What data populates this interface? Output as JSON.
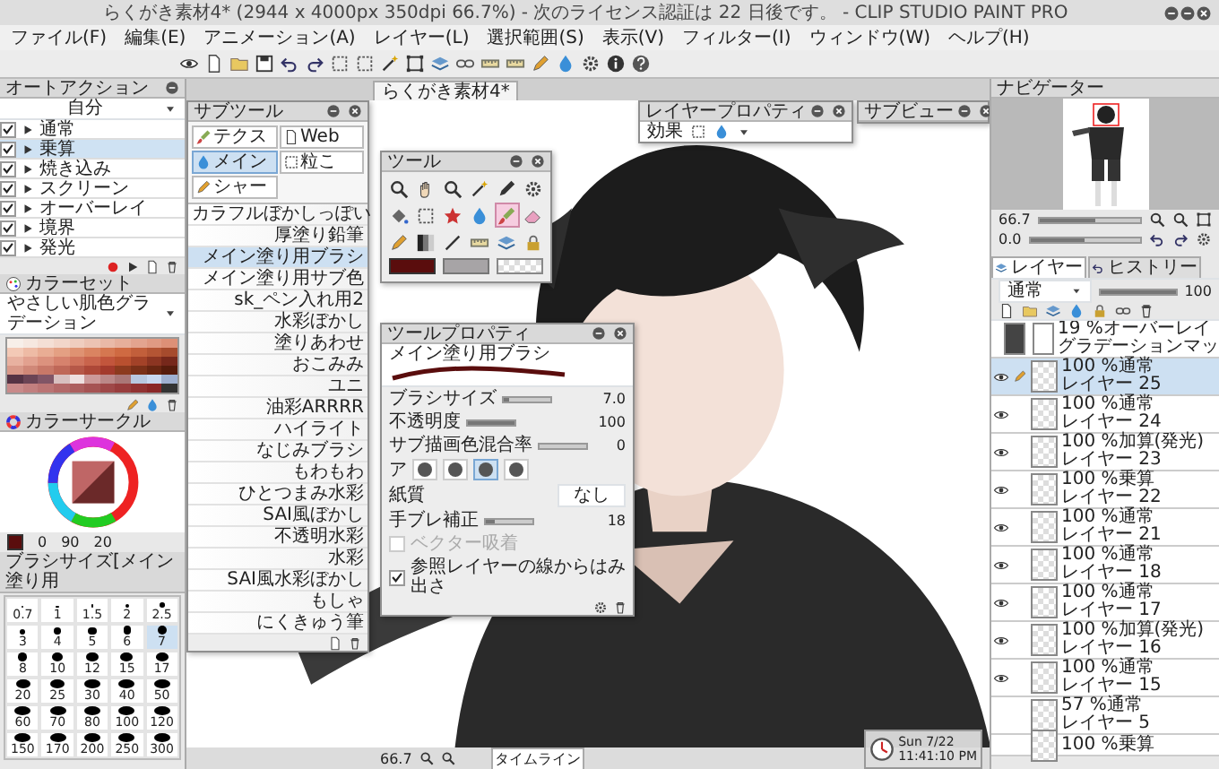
{
  "window": {
    "title": "らくがき素材4* (2944 x 4000px 350dpi 66.7%) - 次のライセンス認証は 22 日後です。 - CLIP STUDIO PAINT PRO"
  },
  "menu": [
    "ファイル(F)",
    "編集(E)",
    "アニメーション(A)",
    "レイヤー(L)",
    "選択範囲(S)",
    "表示(V)",
    "フィルター(I)",
    "ウィンドウ(W)",
    "ヘルプ(H)"
  ],
  "auto_action": {
    "title": "オートアクション",
    "set": "自分",
    "items": [
      {
        "label": "通常",
        "checked": true,
        "selected": false
      },
      {
        "label": "乗算",
        "checked": true,
        "selected": true
      },
      {
        "label": "焼き込み",
        "checked": true,
        "selected": false
      },
      {
        "label": "スクリーン",
        "checked": true,
        "selected": false
      },
      {
        "label": "オーバーレイ",
        "checked": true,
        "selected": false
      },
      {
        "label": "境界",
        "checked": true,
        "selected": false
      },
      {
        "label": "発光",
        "checked": true,
        "selected": false
      }
    ]
  },
  "color_set": {
    "title": "カラーセット",
    "set_name": "やさしい肌色グラデーション",
    "swatches": [
      {
        "color": "#f7efe9"
      },
      {
        "color": "#f6e8e0"
      },
      {
        "color": "#f4dfd5"
      },
      {
        "color": "#f2d6ca"
      },
      {
        "color": "#efcdbf"
      },
      {
        "color": "#ecc3b3"
      },
      {
        "color": "#e9b9a7"
      },
      {
        "color": "#e6af9b"
      },
      {
        "color": "#e3a48f"
      },
      {
        "color": "#e09a83"
      },
      {
        "color": "#dd9077"
      },
      {
        "color": "#f3c9b6"
      },
      {
        "color": "#eebba5"
      },
      {
        "color": "#e9ad94"
      },
      {
        "color": "#e4a083"
      },
      {
        "color": "#df9272"
      },
      {
        "color": "#da8461"
      },
      {
        "color": "#d57750"
      },
      {
        "color": "#cf6a42"
      },
      {
        "color": "#c25f3b"
      },
      {
        "color": "#b45534"
      },
      {
        "color": "#a64b2d"
      },
      {
        "color": "#e8b1a0"
      },
      {
        "color": "#e2a18f"
      },
      {
        "color": "#dc927e"
      },
      {
        "color": "#d6826d"
      },
      {
        "color": "#d0735c"
      },
      {
        "color": "#c9644c"
      },
      {
        "color": "#c2553c"
      },
      {
        "color": "#b9502f"
      },
      {
        "color": "#a34228"
      },
      {
        "color": "#8c3522"
      },
      {
        "color": "#76281b"
      },
      {
        "color": "#d99888"
      },
      {
        "color": "#d08878"
      },
      {
        "color": "#c87868"
      },
      {
        "color": "#bf6858"
      },
      {
        "color": "#b65848"
      },
      {
        "color": "#ad4838"
      },
      {
        "color": "#a33a2c"
      },
      {
        "color": "#8c3a1e"
      },
      {
        "color": "#7a3018"
      },
      {
        "color": "#682612"
      },
      {
        "color": "#561c0c"
      },
      {
        "color": "#553344"
      },
      {
        "color": "#6b4455"
      },
      {
        "color": "#815566"
      },
      {
        "color": "#d8c0c0"
      },
      {
        "color": "#eee0e0"
      },
      {
        "color": "#cc9999"
      },
      {
        "color": "#bb8888"
      },
      {
        "color": "#aa7777"
      },
      {
        "color": "#b8c8e0"
      },
      {
        "color": "#c8d8f0"
      },
      {
        "color": "#9fb0d0"
      },
      {
        "color": "#c98a8a"
      },
      {
        "color": "#c27f7f"
      },
      {
        "color": "#bb7474"
      },
      {
        "color": "#b46969"
      },
      {
        "color": "#ad5e5e"
      },
      {
        "color": "#a65353"
      },
      {
        "color": "#9f4848"
      },
      {
        "color": "#983d3d"
      },
      {
        "color": "#913232"
      },
      {
        "color": "#8a2727"
      },
      {
        "color": "#333333"
      }
    ]
  },
  "color_circle": {
    "title": "カラーサークル",
    "values": [
      "0",
      "90",
      "20"
    ]
  },
  "brush_size": {
    "title": "ブラシサイズ[メイン塗り用",
    "sizes": [
      {
        "label": "0.7",
        "selected": false
      },
      {
        "label": "1",
        "selected": false
      },
      {
        "label": "1.5",
        "selected": false
      },
      {
        "label": "2",
        "selected": false
      },
      {
        "label": "2.5",
        "selected": false
      },
      {
        "label": "3",
        "selected": false
      },
      {
        "label": "4",
        "selected": false
      },
      {
        "label": "5",
        "selected": false
      },
      {
        "label": "6",
        "selected": false
      },
      {
        "label": "7",
        "selected": true
      },
      {
        "label": "8",
        "selected": false
      },
      {
        "label": "10",
        "selected": false
      },
      {
        "label": "12",
        "selected": false
      },
      {
        "label": "15",
        "selected": false
      },
      {
        "label": "17",
        "selected": false
      },
      {
        "label": "20",
        "selected": false
      },
      {
        "label": "25",
        "selected": false
      },
      {
        "label": "30",
        "selected": false
      },
      {
        "label": "40",
        "selected": false
      },
      {
        "label": "50",
        "selected": false
      },
      {
        "label": "60",
        "selected": false
      },
      {
        "label": "70",
        "selected": false
      },
      {
        "label": "80",
        "selected": false
      },
      {
        "label": "100",
        "selected": false
      },
      {
        "label": "120",
        "selected": false
      },
      {
        "label": "150",
        "selected": false
      },
      {
        "label": "170",
        "selected": false
      },
      {
        "label": "200",
        "selected": false
      },
      {
        "label": "250",
        "selected": false
      },
      {
        "label": "300",
        "selected": false
      }
    ]
  },
  "canvas_tab": {
    "label": "らくがき素材4*"
  },
  "sub_tool": {
    "title": "サブツール",
    "groups": [
      {
        "label": "テクス",
        "selected": false
      },
      {
        "label": "Web",
        "selected": false
      },
      {
        "label": "メイン",
        "selected": true
      },
      {
        "label": "粒こ",
        "selected": false
      },
      {
        "label": "シャー",
        "selected": false
      }
    ],
    "brushes": [
      {
        "label": "カラフルぼかしっぽい",
        "selected": false
      },
      {
        "label": "厚塗り鉛筆",
        "selected": false
      },
      {
        "label": "メイン塗り用ブラシ",
        "selected": true
      },
      {
        "label": "メイン塗り用サブ色",
        "selected": false
      },
      {
        "label": "sk_ペン入れ用2",
        "selected": false
      },
      {
        "label": "水彩ぼかし",
        "selected": false
      },
      {
        "label": "塗りあわせ",
        "selected": false
      },
      {
        "label": "おこみみ",
        "selected": false
      },
      {
        "label": "ユニ",
        "selected": false
      },
      {
        "label": "油彩ARRRR",
        "selected": false
      },
      {
        "label": "ハイライト",
        "selected": false
      },
      {
        "label": "なじみブラシ",
        "selected": false
      },
      {
        "label": "もわもわ",
        "selected": false
      },
      {
        "label": "ひとつまみ水彩",
        "selected": false
      },
      {
        "label": "SAI風ぼかし",
        "selected": false
      },
      {
        "label": "不透明水彩",
        "selected": false
      },
      {
        "label": "水彩",
        "selected": false
      },
      {
        "label": "SAI風水彩ぼかし",
        "selected": false
      },
      {
        "label": "もしゃ",
        "selected": false
      },
      {
        "label": "にくきゅう筆",
        "selected": false
      }
    ]
  },
  "tool": {
    "title": "ツール",
    "tools": [
      {
        "selected": false
      },
      {
        "selected": false
      },
      {
        "selected": false
      },
      {
        "selected": false
      },
      {
        "selected": false
      },
      {
        "selected": false
      },
      {
        "selected": false
      },
      {
        "selected": false
      },
      {
        "selected": false
      },
      {
        "selected": false
      },
      {
        "selected": true
      },
      {
        "selected": false
      },
      {
        "selected": false
      },
      {
        "selected": false
      },
      {
        "selected": false
      },
      {
        "selected": false
      },
      {
        "selected": false
      },
      {
        "selected": false
      }
    ]
  },
  "tool_property": {
    "title": "ツールプロパティ",
    "brush": "メイン塗り用ブラシ",
    "sliders": [
      {
        "label": "ブラシサイズ",
        "value": "7.0",
        "level": 0.1
      },
      {
        "label": "不透明度",
        "value": "100",
        "level": 1
      },
      {
        "label": "サブ描画色混合率",
        "value": "0",
        "level": 0
      }
    ],
    "tip_label": "ア",
    "tips": [
      {
        "selected": false
      },
      {
        "selected": false
      },
      {
        "selected": true
      },
      {
        "selected": false
      }
    ],
    "paper_label": "紙質",
    "paper_value": "なし",
    "stabilization": {
      "label": "手ブレ補正",
      "value": "18",
      "level": 0.18
    },
    "vector_snap": {
      "label": "ベクター吸着",
      "checked": false,
      "disabled": true
    },
    "reference": {
      "label": "参照レイヤーの線からはみ出さ",
      "checked": true
    }
  },
  "layer_property": {
    "title": "レイヤープロパティ",
    "effect_label": "効果"
  },
  "sub_view": {
    "title": "サブビュー"
  },
  "canvas_status": {
    "zoom": "66.7"
  },
  "timeline": {
    "label": "タイムライン"
  },
  "navigator": {
    "title": "ナビゲーター",
    "zoom": "66.7",
    "zoom_slider": {
      "level": 0.55
    },
    "rotation": "0.0",
    "rotation_slider": {
      "level": 0.5
    }
  },
  "layer_panel": {
    "tabs": [
      {
        "label": "レイヤー",
        "selected": true
      },
      {
        "label": "ヒストリー",
        "selected": false
      }
    ],
    "blend": "通常",
    "opacity": "100",
    "opacity_slider": {
      "level": 1
    },
    "layers": [
      {
        "kind": "correction",
        "mode": "19 %オーバーレイ",
        "label": "グラデーションマッ",
        "visible": false,
        "editing": false,
        "selected": false
      },
      {
        "kind": "raster",
        "mode": "100 %通常",
        "label": "レイヤー 25",
        "visible": true,
        "editing": true,
        "selected": true
      },
      {
        "kind": "raster",
        "mode": "100 %通常",
        "label": "レイヤー 24",
        "visible": true,
        "editing": false,
        "selected": false
      },
      {
        "kind": "raster",
        "mode": "100 %加算(発光)",
        "label": "レイヤー 23",
        "visible": true,
        "editing": false,
        "selected": false
      },
      {
        "kind": "raster",
        "mode": "100 %乗算",
        "label": "レイヤー 22",
        "visible": true,
        "editing": false,
        "selected": false
      },
      {
        "kind": "raster",
        "mode": "100 %通常",
        "label": "レイヤー 21",
        "visible": true,
        "editing": false,
        "selected": false
      },
      {
        "kind": "raster",
        "mode": "100 %通常",
        "label": "レイヤー 18",
        "visible": true,
        "editing": false,
        "selected": false
      },
      {
        "kind": "raster",
        "mode": "100 %通常",
        "label": "レイヤー 17",
        "visible": true,
        "editing": false,
        "selected": false
      },
      {
        "kind": "raster",
        "mode": "100 %加算(発光)",
        "label": "レイヤー 16",
        "visible": true,
        "editing": false,
        "selected": false
      },
      {
        "kind": "raster",
        "mode": "100 %通常",
        "label": "レイヤー 15",
        "visible": true,
        "editing": false,
        "selected": false
      },
      {
        "kind": "raster",
        "mode": "57 %通常",
        "label": "レイヤー 5",
        "visible": false,
        "editing": false,
        "selected": false
      },
      {
        "kind": "raster",
        "mode": "100 %乗算",
        "visible": false,
        "editing": false,
        "selected": false
      }
    ]
  },
  "clock": {
    "date": "Sun 7/22",
    "time": "11:41:10 PM"
  }
}
